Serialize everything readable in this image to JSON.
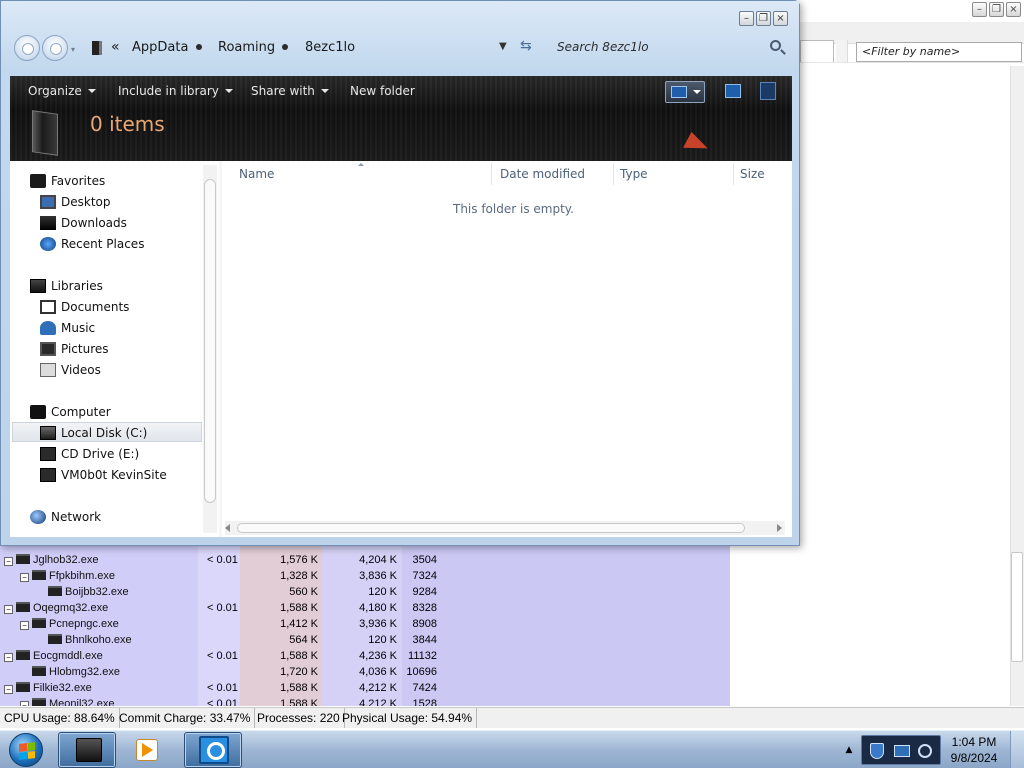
{
  "explorer": {
    "breadcrumbs": [
      "AppData",
      "Roaming",
      "8ezc1lo"
    ],
    "overflow_chevron": "«",
    "search_placeholder": "Search 8ezc1lo",
    "toolbar": {
      "organize": "Organize",
      "include_in_library": "Include in library",
      "share_with": "Share with",
      "new_folder": "New folder"
    },
    "item_count": "0 items",
    "columns": [
      "Name",
      "Date modified",
      "Type",
      "Size"
    ],
    "empty_message": "This folder is empty.",
    "nav": {
      "favorites": "Favorites",
      "desktop": "Desktop",
      "downloads": "Downloads",
      "recent_places": "Recent Places",
      "libraries": "Libraries",
      "documents": "Documents",
      "music": "Music",
      "pictures": "Pictures",
      "videos": "Videos",
      "computer": "Computer",
      "local_disk": "Local Disk (C:)",
      "cd_drive": "CD Drive (E:)",
      "network_drive": "VM0b0t KevinSite",
      "network": "Network"
    },
    "selected_nav_item": "Local Disk (C:)"
  },
  "process_explorer": {
    "filter_placeholder": "<Filter by name>",
    "rows": [
      {
        "name": "Jglhob32.exe",
        "level": 0,
        "expander": "−",
        "cpu": "< 0.01",
        "private_bytes": "1,576 K",
        "working_set": "4,204 K",
        "pid": "3504"
      },
      {
        "name": "Ffpkbihm.exe",
        "level": 1,
        "expander": "−",
        "cpu": "",
        "private_bytes": "1,328 K",
        "working_set": "3,836 K",
        "pid": "7324"
      },
      {
        "name": "Boijbb32.exe",
        "level": 2,
        "expander": "",
        "cpu": "",
        "private_bytes": "560 K",
        "working_set": "120 K",
        "pid": "9284"
      },
      {
        "name": "Oqegmq32.exe",
        "level": 0,
        "expander": "−",
        "cpu": "< 0.01",
        "private_bytes": "1,588 K",
        "working_set": "4,180 K",
        "pid": "8328"
      },
      {
        "name": "Pcnepngc.exe",
        "level": 1,
        "expander": "−",
        "cpu": "",
        "private_bytes": "1,412 K",
        "working_set": "3,936 K",
        "pid": "8908"
      },
      {
        "name": "Bhnlkoho.exe",
        "level": 2,
        "expander": "",
        "cpu": "",
        "private_bytes": "564 K",
        "working_set": "120 K",
        "pid": "3844"
      },
      {
        "name": "Eocgmddl.exe",
        "level": 0,
        "expander": "−",
        "cpu": "< 0.01",
        "private_bytes": "1,588 K",
        "working_set": "4,236 K",
        "pid": "11132"
      },
      {
        "name": "Hlobmg32.exe",
        "level": 1,
        "expander": "",
        "cpu": "",
        "private_bytes": "1,720 K",
        "working_set": "4,036 K",
        "pid": "10696"
      },
      {
        "name": "Filkie32.exe",
        "level": 0,
        "expander": "−",
        "cpu": "< 0.01",
        "private_bytes": "1,588 K",
        "working_set": "4,212 K",
        "pid": "7424"
      },
      {
        "name": "Meonil32.exe",
        "level": 1,
        "expander": "−",
        "cpu": "< 0.01",
        "private_bytes": "1,588 K",
        "working_set": "4,212 K",
        "pid": "1528"
      }
    ],
    "status": {
      "cpu": "CPU Usage: 88.64%",
      "commit": "Commit Charge: 33.47%",
      "processes": "Processes: 220",
      "physical": "Physical Usage: 54.94%"
    }
  },
  "taskbar": {
    "time": "1:04 PM",
    "date": "9/8/2024",
    "pinned": [
      "windows-explorer",
      "media-player",
      "process-explorer"
    ]
  },
  "colors": {
    "explorer_frame": "#c2d8ee",
    "command_bar": "#111111",
    "item_count_text": "#e9a773",
    "pe_tree_bg": "#d0cdf8",
    "pe_private_bytes_bg": "#e2ccd6"
  }
}
